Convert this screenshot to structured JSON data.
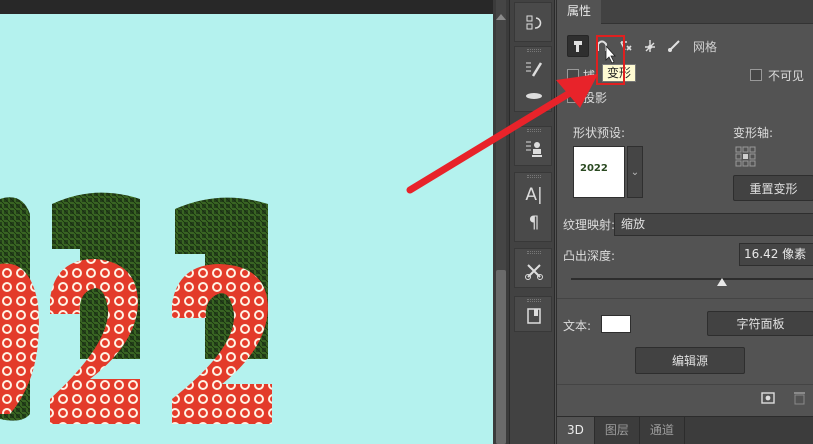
{
  "panel": {
    "tab_title": "属性",
    "mesh_label": "网格",
    "capture_label": "捕",
    "invisible_label": "不可见",
    "shadow_label": "投影",
    "shape_preset_label": "形状预设:",
    "deform_axis_label": "变形轴:",
    "reset_deform_button": "重置变形",
    "texture_mapping_label": "纹理映射:",
    "texture_mapping_value": "缩放",
    "extrude_depth_label": "凸出深度:",
    "extrude_depth_value": "16.42 像素",
    "extrude_depth_fraction": 0.62,
    "text_label": "文本:",
    "text_color": "#ffffff",
    "char_panel_button": "字符面板",
    "edit_source_button": "编辑源",
    "preset_thumb_text": "2022"
  },
  "tooltip": {
    "text": "变形"
  },
  "bottom_tabs": [
    {
      "label": "3D",
      "active": true
    },
    {
      "label": "图层",
      "active": false
    },
    {
      "label": "通道",
      "active": false
    }
  ],
  "canvas": {
    "digits": "022",
    "background": "#b4f2ee"
  },
  "colors": {
    "highlight": "#e02020",
    "arrow": "#e8232a"
  }
}
